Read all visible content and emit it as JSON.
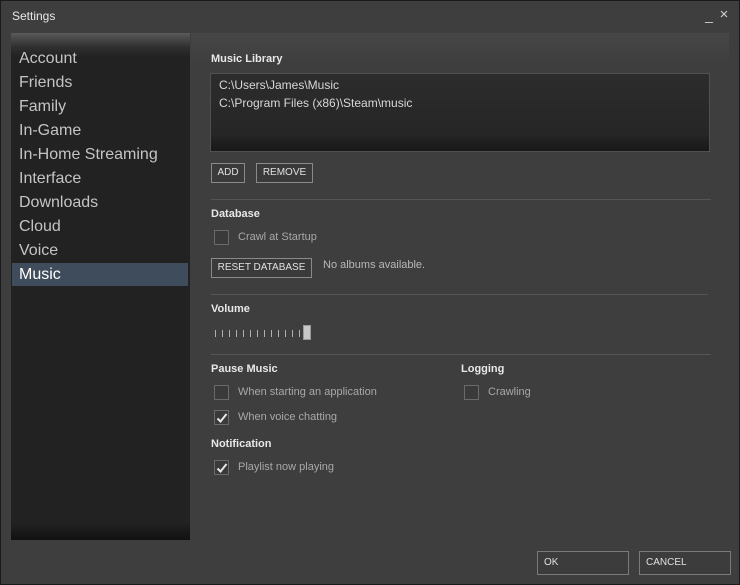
{
  "window": {
    "title": "Settings",
    "minimize_glyph": "_",
    "close_glyph": "×"
  },
  "sidebar": {
    "items": [
      {
        "label": "Account"
      },
      {
        "label": "Friends"
      },
      {
        "label": "Family"
      },
      {
        "label": "In-Game"
      },
      {
        "label": "In-Home Streaming"
      },
      {
        "label": "Interface"
      },
      {
        "label": "Downloads"
      },
      {
        "label": "Cloud"
      },
      {
        "label": "Voice"
      },
      {
        "label": "Music"
      }
    ],
    "active_index": 9
  },
  "music_library": {
    "header": "Music Library",
    "paths": [
      "C:\\Users\\James\\Music",
      "C:\\Program Files (x86)\\Steam\\music"
    ],
    "add_label": "ADD",
    "remove_label": "REMOVE"
  },
  "database": {
    "header": "Database",
    "crawl_label": "Crawl at Startup",
    "crawl_checked": false,
    "reset_label": "RESET DATABASE",
    "status": "No albums available."
  },
  "volume": {
    "header": "Volume",
    "level": 1.0
  },
  "pause_music": {
    "header": "Pause Music",
    "starting_app_label": "When starting an application",
    "starting_app_checked": false,
    "voice_chatting_label": "When voice chatting",
    "voice_chatting_checked": true
  },
  "logging": {
    "header": "Logging",
    "crawling_label": "Crawling",
    "crawling_checked": false
  },
  "notification": {
    "header": "Notification",
    "playlist_label": "Playlist now playing",
    "playlist_checked": true
  },
  "footer": {
    "ok_label": "OK",
    "cancel_label": "CANCEL"
  },
  "colors": {
    "active_item_bg": "#3e4c5c",
    "window_bg": "#3e3e3f"
  }
}
